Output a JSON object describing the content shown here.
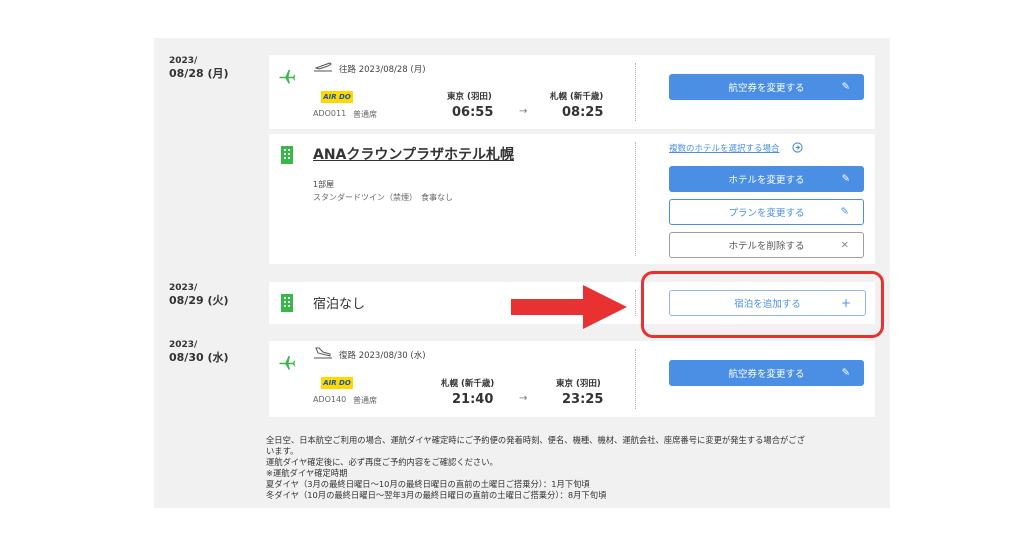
{
  "days": [
    {
      "year": "2023/",
      "date": "08/28 (月)"
    },
    {
      "year": "2023/",
      "date": "08/29 (火)"
    },
    {
      "year": "2023/",
      "date": "08/30 (水)"
    }
  ],
  "outbound": {
    "label": "往路 2023/08/28 (月)",
    "airline_logo": "AIR DO",
    "flight": "ADO011",
    "seat_class": "普通席",
    "from_airport": "東京 (羽田)",
    "from_time": "06:55",
    "to_airport": "札幌 (新千歳)",
    "to_time": "08:25",
    "arrow": "→",
    "change_ticket_label": "航空券を変更する"
  },
  "hotel": {
    "name": "ANAクラウンプラザホテル札幌",
    "rooms": "1部屋",
    "room_detail": "スタンダードツイン（禁煙）　食事なし",
    "multi_hotel_link": "複数のホテルを選択する場合",
    "change_hotel_label": "ホテルを変更する",
    "change_plan_label": "プランを変更する",
    "delete_hotel_label": "ホテルを削除する",
    "delete_icon": "×"
  },
  "no_stay": {
    "text": "宿泊なし",
    "add_stay_label": "宿泊を追加する",
    "add_icon": "+"
  },
  "return": {
    "label": "復路 2023/08/30 (水)",
    "airline_logo": "AIR DO",
    "flight": "ADO140",
    "seat_class": "普通席",
    "from_airport": "札幌 (新千歳)",
    "from_time": "21:40",
    "to_airport": "東京 (羽田)",
    "to_time": "23:25",
    "arrow": "→",
    "change_ticket_label": "航空券を変更する"
  },
  "notes": [
    "全日空、日本航空ご利用の場合、運航ダイヤ確定時にご予約便の発着時刻、便名、機種、機材、運航会社、座席番号に変更が発生する場合がござ",
    "います。",
    "運航ダイヤ確定後に、必ず再度ご予約内容をご確認ください。",
    "※運航ダイヤ確定時期",
    "夏ダイヤ（3月の最終日曜日～10月の最終日曜日の直前の土曜日ご搭乗分）：1月下旬頃",
    "冬ダイヤ（10月の最終日曜日～翌年3月の最終日曜日の直前の土曜日ご搭乗分）：8月下旬頃"
  ],
  "colors": {
    "accent_blue": "#4a8fe3",
    "icon_green": "#39b84a",
    "highlight_red": "#e83131",
    "panel_gray": "#f1f1f1"
  },
  "icons": {
    "plane": "airplane-icon",
    "takeoff": "takeoff-icon",
    "landing": "landing-icon",
    "hotel": "hotel-building-icon",
    "edit": "pencil-icon",
    "help": "circle-arrow-icon"
  }
}
